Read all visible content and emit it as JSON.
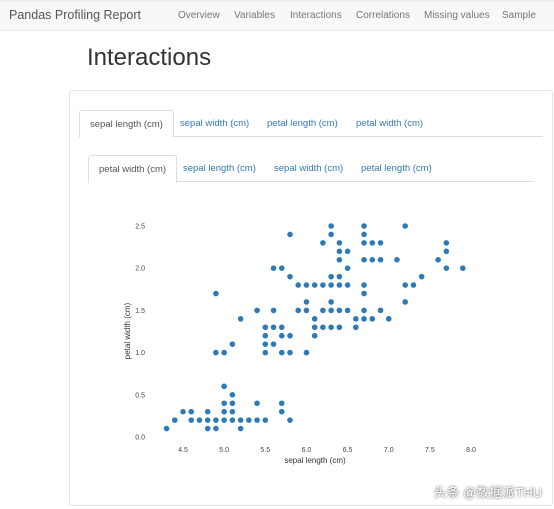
{
  "nav": {
    "brand": "Pandas Profiling Report",
    "items": [
      "Overview",
      "Variables",
      "Interactions",
      "Correlations",
      "Missing values",
      "Sample"
    ]
  },
  "page_title": "Interactions",
  "tabs_outer": [
    "sepal length (cm)",
    "sepal width (cm)",
    "petal length (cm)",
    "petal width (cm)"
  ],
  "tabs_inner": [
    "petal width (cm)",
    "sepal length (cm)",
    "sepal width (cm)",
    "petal length (cm)"
  ],
  "watermark": "头条 @数据派THU",
  "chart_data": {
    "type": "scatter",
    "xlabel": "sepal length (cm)",
    "ylabel": "petal width (cm)",
    "xlim": [
      4.2,
      8.0
    ],
    "ylim": [
      0,
      2.5
    ],
    "xticks": [
      "4.5",
      "5.0",
      "5.5",
      "6.0",
      "6.5",
      "7.0",
      "7.5",
      "8.0"
    ],
    "yticks": [
      "0.0",
      "0.5",
      "1.0",
      "1.5",
      "2.0",
      "2.5"
    ],
    "color": "#2e7ab8",
    "grid": false,
    "points": {
      "2.5": [
        6.3,
        6.7,
        7.2
      ],
      "2.4": [
        5.8,
        6.3,
        6.7
      ],
      "2.3": [
        6.2,
        6.4,
        6.7,
        6.8,
        6.9,
        7.7
      ],
      "2.2": [
        6.4,
        6.5,
        7.7
      ],
      "2.1": [
        6.4,
        6.7,
        6.8,
        6.9,
        7.1,
        7.6
      ],
      "2.0": [
        5.6,
        5.7,
        6.5,
        7.7,
        7.9
      ],
      "1.9": [
        5.8,
        6.3,
        6.4,
        7.4
      ],
      "1.8": [
        5.9,
        6.0,
        6.1,
        6.2,
        6.3,
        6.4,
        6.5,
        6.7,
        7.2,
        7.3
      ],
      "1.7": [
        4.9,
        6.7
      ],
      "1.6": [
        6.0,
        6.3,
        7.2
      ],
      "1.5": [
        5.4,
        5.6,
        5.9,
        6.0,
        6.2,
        6.3,
        6.4,
        6.5,
        6.7,
        6.9
      ],
      "1.4": [
        5.2,
        6.1,
        6.6,
        6.7,
        6.8,
        7.0
      ],
      "1.3": [
        5.5,
        5.6,
        5.7,
        6.1,
        6.2,
        6.3,
        6.4,
        6.6
      ],
      "1.2": [
        5.5,
        5.7,
        5.8,
        6.1
      ],
      "1.1": [
        5.1,
        5.5,
        5.6
      ],
      "1.0": [
        4.9,
        5.0,
        5.5,
        5.7,
        5.8,
        6.0
      ],
      "0.6": [
        5.0
      ],
      "0.5": [
        5.1
      ],
      "0.4": [
        5.0,
        5.1,
        5.4,
        5.7
      ],
      "0.3": [
        4.5,
        4.6,
        4.8,
        5.0,
        5.1,
        5.7
      ],
      "0.2": [
        4.4,
        4.6,
        4.7,
        4.8,
        4.9,
        5.0,
        5.1,
        5.2,
        5.3,
        5.4,
        5.5,
        5.8
      ],
      "0.1": [
        4.3,
        4.8,
        4.9,
        5.2
      ]
    }
  }
}
